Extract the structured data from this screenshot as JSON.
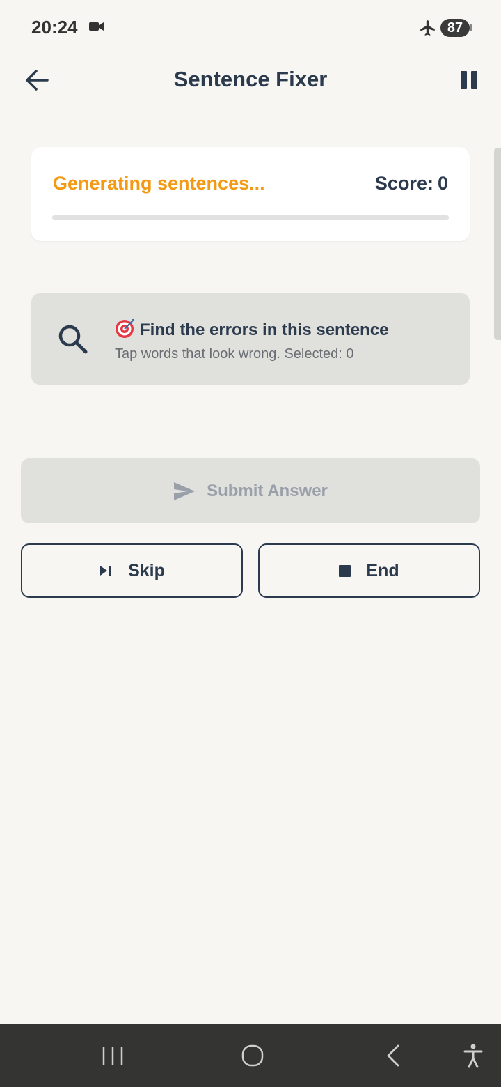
{
  "status_bar": {
    "time": "20:24",
    "battery": "87"
  },
  "header": {
    "title": "Sentence Fixer"
  },
  "score_card": {
    "status_text": "Generating sentences...",
    "score_label": "Score:",
    "score_value": "0",
    "progress_percent": 0,
    "accent_color": "#f39a14"
  },
  "hint": {
    "title": "Find the errors in this sentence",
    "subtitle": "Tap words that look wrong. Selected: 0"
  },
  "actions": {
    "submit_label": "Submit Answer",
    "skip_label": "Skip",
    "end_label": "End"
  },
  "icons": {
    "back": "arrow-left",
    "pause": "pause",
    "search": "magnifier",
    "target": "direct-hit-emoji",
    "submit": "send",
    "skip": "skip-next",
    "end": "stop"
  },
  "colors": {
    "background": "#f7f6f3",
    "text": "#2c3a4e",
    "disabled": "#e0e0dc",
    "nav_bar": "#343432"
  }
}
